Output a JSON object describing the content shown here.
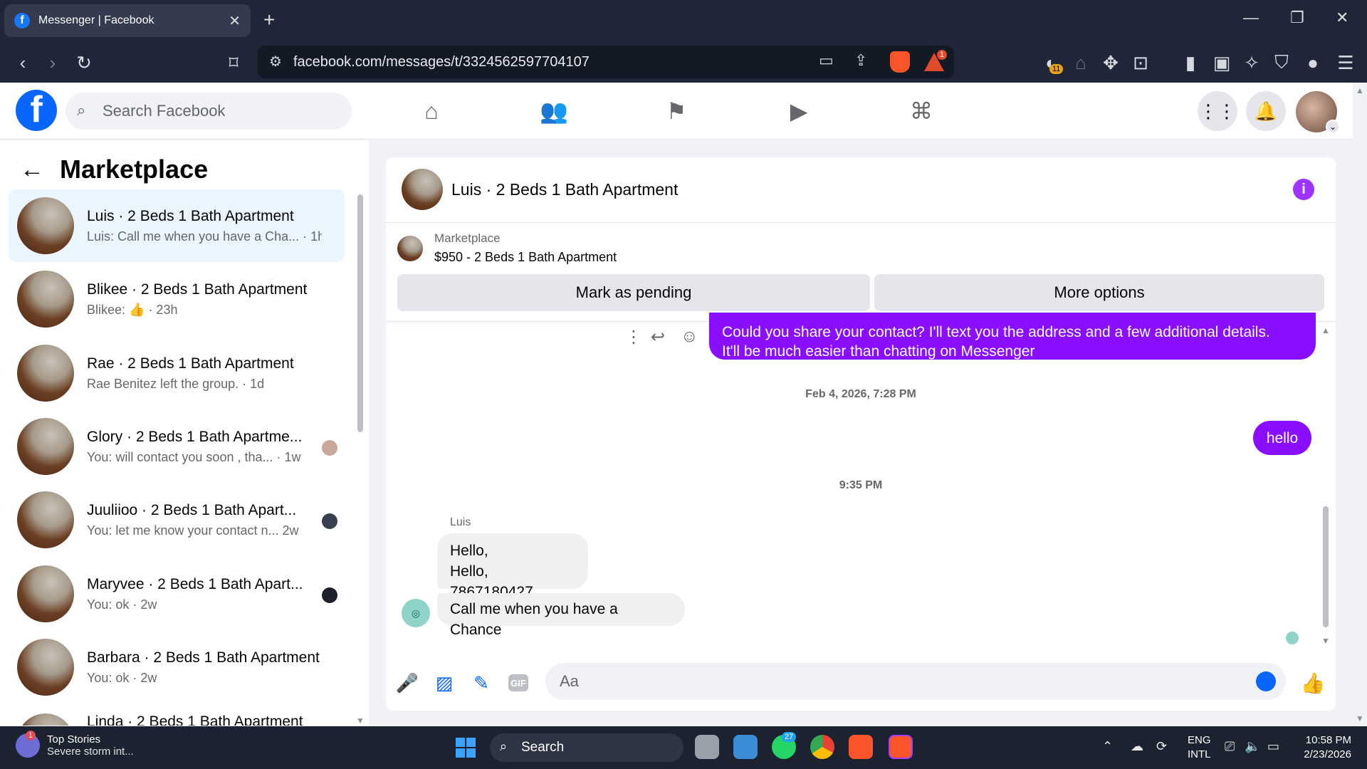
{
  "browser": {
    "tab_title": "Messenger | Facebook",
    "url": "facebook.com/messages/t/3324562597704107",
    "extension_badge": "11",
    "alert_badge": "1"
  },
  "fb": {
    "search_placeholder": "Search Facebook"
  },
  "sidebar": {
    "title": "Marketplace",
    "conversations": [
      {
        "name": "Luis · 2 Beds 1 Bath Apartment",
        "preview": "Luis: Call me when you have a Cha... · 1h"
      },
      {
        "name": "Blikee · 2 Beds 1 Bath Apartment",
        "preview": "Blikee: 👍 · 23h"
      },
      {
        "name": "Rae · 2 Beds 1 Bath Apartment",
        "preview": "Rae Benitez left the group. · 1d"
      },
      {
        "name": "Glory · 2 Beds 1 Bath Apartme...",
        "preview": "You: will contact you soon , tha... · 1w"
      },
      {
        "name": "Juuliioo · 2 Beds 1 Bath Apart...",
        "preview": "You: let me know your contact n... 2w"
      },
      {
        "name": "Maryvee · 2 Beds 1 Bath Apart...",
        "preview": "You: ok · 2w"
      },
      {
        "name": "Barbara · 2 Beds 1 Bath Apartment",
        "preview": "You: ok · 2w"
      },
      {
        "name": "Linda · 2 Beds 1 Bath Apartment",
        "preview": ""
      }
    ]
  },
  "chat": {
    "header_name": "Luis · 2 Beds 1 Bath Apartment",
    "marketplace_label": "Marketplace",
    "listing": "$950 - 2 Beds 1 Bath Apartment",
    "mark_pending": "Mark as pending",
    "more_options": "More options",
    "out_msg_1_line1": "Could you share your contact? I'll text you the address and a few additional details.",
    "out_msg_1_line2": "It'll be much easier than chatting on Messenger",
    "timestamp_1": "Feb 4, 2026, 7:28 PM",
    "out_msg_2": "hello",
    "timestamp_2": "9:35 PM",
    "sender": "Luis",
    "in_msg_1_line1": "Hello,",
    "in_msg_1_line2": "Hello, 7867180427",
    "in_msg_2": "Call me when you have a Chance",
    "composer_placeholder": "Aa",
    "gif_label": "GIF"
  },
  "taskbar": {
    "news_title": "Top Stories",
    "news_sub": "Severe storm int...",
    "news_badge": "1",
    "search": "Search",
    "whatsapp_badge": "27",
    "lang_1": "ENG",
    "lang_2": "INTL",
    "time": "10:58 PM",
    "date": "2/23/2026"
  }
}
